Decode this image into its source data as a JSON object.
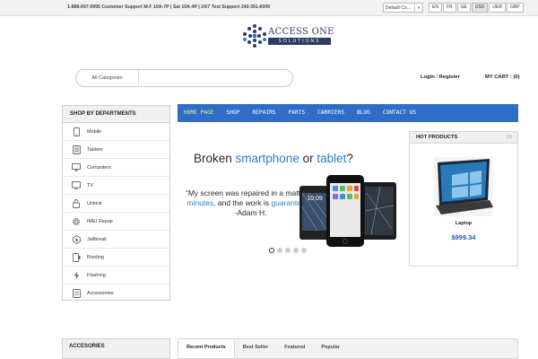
{
  "topbar": {
    "support_text": "1-888-697-0995 Customer Support M-F 10A-7P | Sat 10A-4P | 24/7 Text Support 240-391-6009",
    "store_select": "Default Co...",
    "languages": [
      "EN",
      "FR",
      "GE",
      "USD",
      "UER",
      "GBP"
    ],
    "active_language": "USD"
  },
  "logo": {
    "line1": "ACCESS ONE",
    "line2": "SOLUTIONS"
  },
  "search": {
    "category": "All Categories",
    "query": ""
  },
  "account": {
    "login": "Login",
    "separator": "/",
    "register": "Register",
    "cart": "MY CART : (0)"
  },
  "departments": {
    "title": "SHOP BY DEPARTMENTS",
    "items": [
      {
        "label": "Mobile",
        "icon": "mobile-icon"
      },
      {
        "label": "Tablets",
        "icon": "tablet-icon"
      },
      {
        "label": "Computers",
        "icon": "computer-icon"
      },
      {
        "label": "TV",
        "icon": "tv-icon"
      },
      {
        "label": "Unlock",
        "icon": "unlock-icon"
      },
      {
        "label": "IMEI Repair",
        "icon": "gear-icon"
      },
      {
        "label": "Jailbreak",
        "icon": "jailbreak-icon"
      },
      {
        "label": "Rooting",
        "icon": "rooting-icon"
      },
      {
        "label": "Flashing",
        "icon": "flash-icon"
      },
      {
        "label": "Accessories",
        "icon": "accessories-icon"
      }
    ]
  },
  "nav": {
    "items": [
      "HOME PAGE",
      "SHOP",
      "REPAIRS",
      "PARTS",
      "CARRIERS",
      "BLOG",
      "CONTACT US"
    ]
  },
  "banner": {
    "title_a": "Broken ",
    "title_b": "smartphone",
    "title_c": " or ",
    "title_d": "tablet",
    "title_e": "?",
    "quote_a": "“My screen was repaired in a matter of ",
    "quote_b": "minutes",
    "quote_c": ", and the work is ",
    "quote_d": "guaranteed",
    "quote_e": ".”",
    "quote_author": "-Adam H.",
    "phone_time": "10:09",
    "slides": 5,
    "active_slide": 1
  },
  "hot_products": {
    "title": "HOT PRODUCTS",
    "counter": "1/5",
    "name": "Laptop",
    "price": "$999.34"
  },
  "bottom": {
    "accessories_title": "ACCESORIES",
    "tabs": [
      "Recent Products",
      "Best Seller",
      "Featured",
      "Popular"
    ]
  },
  "colors": {
    "nav": "#2f6ec8",
    "accent": "#2d7fc4",
    "price": "#2563b5"
  }
}
